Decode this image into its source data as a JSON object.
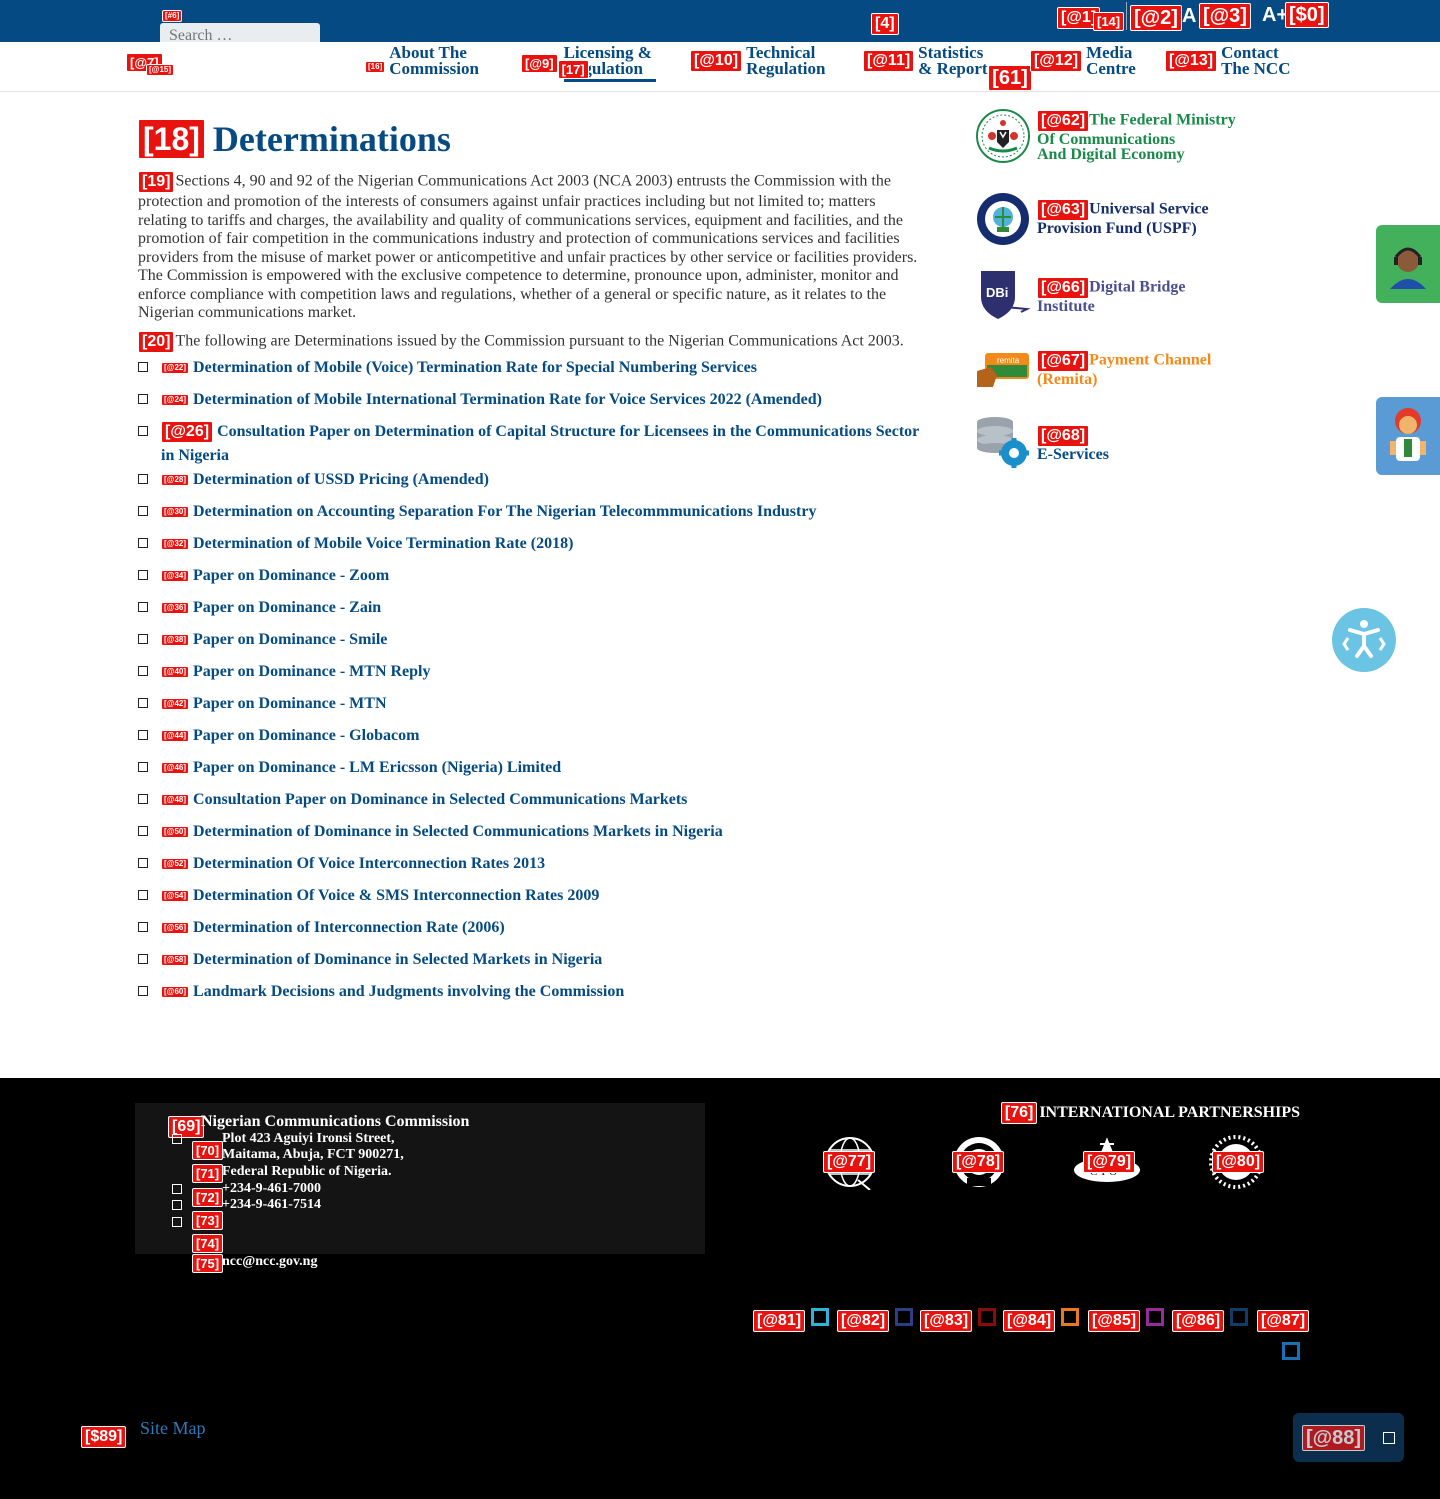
{
  "colors": {
    "primary": "#054a82",
    "tag": "#e8130f",
    "footer_bg": "#000000",
    "fmi_green": "#1a8a4a",
    "uspf_navy": "#152d6e",
    "dbi_purple": "#4b4e8f",
    "remita_orange": "#f28a1a"
  },
  "topbar": {
    "search_tag": "[#6]",
    "search_placeholder": "Search …",
    "tag_4": "[4]",
    "tag_a1": "[@1]",
    "tag_14": "[14]",
    "tag_a2": "[@2]",
    "font_normal": "A",
    "tag_a3": "[@3]",
    "font_plus": "A+",
    "tag_0": "[$0]"
  },
  "nav": {
    "logo_tag": "[@7]",
    "logo_tag_small": "[@15]",
    "items": [
      {
        "tag": "[16]",
        "line1": "About The",
        "line2": "Commission"
      },
      {
        "tag": "[@9]",
        "tag2": "[17]",
        "line1": "Licensing &",
        "line2": "Regulation"
      },
      {
        "tag": "[@10]",
        "line1": "Technical",
        "line2": "Regulation"
      },
      {
        "tag": "[@11]",
        "tag2": "[61]",
        "line1": "Statistics",
        "line2": "& Reports"
      },
      {
        "tag": "[@12]",
        "line1": "Media",
        "line2": "Centre"
      },
      {
        "tag": "[@13]",
        "line1": "Contact",
        "line2": "The NCC"
      }
    ]
  },
  "main": {
    "title_tag": "[18]",
    "title": "Determinations",
    "intro1_tag": "[19]",
    "intro1": "Sections 4, 90 and 92 of the Nigerian Communications Act 2003 (NCA 2003) entrusts the Commission with the protection and promotion of the interests of consumers against unfair practices including but not limited to; matters relating to tariffs and charges, the availability and quality of communications services, equipment and facilities, and the promotion of fair competition in the communications industry and protection of communications services and facilities providers from the misuse of market power or anticompetitive and unfair practices by other service or facilities providers. The Commission is empowered with the exclusive competence to determine, pronounce upon, administer, monitor and enforce compliance with competition laws and regulations, whether of a general or specific nature, as it relates to the Nigerian communications market.",
    "intro2_tag": "[20]",
    "intro2": "The following are Determinations issued by the Commission pursuant to the Nigerian Communications Act 2003.",
    "documents": [
      {
        "tag": "[@22]",
        "title": "Determination of Mobile (Voice) Termination Rate for Special Numbering Services"
      },
      {
        "tag": "[@24]",
        "title": "Determination of Mobile International Termination Rate for Voice Services 2022 (Amended)"
      },
      {
        "tag": "[@26]",
        "title": "Consultation Paper on Determination of Capital Structure for Licensees in the Communications Sector in Nigeria"
      },
      {
        "tag": "[@28]",
        "title": "Determination of USSD Pricing (Amended)"
      },
      {
        "tag": "[@30]",
        "title": "Determination on Accounting Separation For The Nigerian Telecommmunications Industry"
      },
      {
        "tag": "[@32]",
        "title": "Determination of Mobile Voice Termination Rate (2018)"
      },
      {
        "tag": "[@34]",
        "title": "Paper on Dominance - Zoom"
      },
      {
        "tag": "[@36]",
        "title": "Paper on Dominance - Zain"
      },
      {
        "tag": "[@38]",
        "title": "Paper on Dominance - Smile"
      },
      {
        "tag": "[@40]",
        "title": "Paper on Dominance - MTN Reply"
      },
      {
        "tag": "[@42]",
        "title": "Paper on Dominance - MTN"
      },
      {
        "tag": "[@44]",
        "title": "Paper on Dominance - Globacom"
      },
      {
        "tag": "[@46]",
        "title": "Paper on Dominance - LM Ericsson (Nigeria) Limited"
      },
      {
        "tag": "[@48]",
        "title": "Consultation Paper on Dominance in Selected Communications Markets"
      },
      {
        "tag": "[@50]",
        "title": "Determination of Dominance in Selected Communications Markets in Nigeria"
      },
      {
        "tag": "[@52]",
        "title": "Determination Of Voice Interconnection Rates 2013"
      },
      {
        "tag": "[@54]",
        "title": "Determination Of Voice & SMS Interconnection Rates 2009"
      },
      {
        "tag": "[@56]",
        "title": "Determination of Interconnection Rate (2006)"
      },
      {
        "tag": "[@58]",
        "title": "Determination of Dominance in Selected Markets in Nigeria"
      },
      {
        "tag": "[@60]",
        "title": "Landmark Decisions and Judgments involving the Commission"
      }
    ]
  },
  "sidebar": {
    "items": [
      {
        "tag": "[@62]",
        "line1": "The Federal Ministry",
        "line2": "Of Communications",
        "line3": "And Digital Economy",
        "icon": "nigeria-coat-of-arms-icon"
      },
      {
        "tag": "[@63]",
        "line1": "Universal Service",
        "line2": "Provision Fund (USPF)",
        "icon": "uspf-logo-icon"
      },
      {
        "tag": "[@66]",
        "line1": "Digital Bridge",
        "line2": "Institute",
        "icon": "dbi-logo-icon"
      },
      {
        "tag": "[@67]",
        "line1": "Payment Channel",
        "line2": "(Remita)",
        "icon": "remita-card-icon"
      },
      {
        "tag": "[@68]",
        "line1": "",
        "line2": "E-Services",
        "icon": "database-gear-icon"
      }
    ]
  },
  "footer": {
    "contact_tag": "[69]",
    "org_name": "Nigerian Communications Commission",
    "addr_tag1": "[70]",
    "addr1": "Plot 423 Aguiyi Ironsi Street,",
    "addr2": "Maitama, Abuja, FCT 900271,",
    "addr_tag2": "[71]",
    "addr3": "Federal Republic of Nigeria.",
    "phone_tag": "[72]",
    "phone1": "+234-9-461-7000",
    "phone2": "+234-9-461-7514",
    "tag_73": "[73]",
    "tag_74": "[74]",
    "email_tag": "[75]",
    "email": "ncc@ncc.gov.ng",
    "partners_tag": "[76]",
    "partners_title": "INTERNATIONAL PARTNERSHIPS",
    "partners": [
      {
        "tag": "[@77]",
        "icon": "itu-globe-icon"
      },
      {
        "tag": "[@78]",
        "icon": "atu-emblem-icon"
      },
      {
        "tag": "[@79]",
        "icon": "cto-logo-icon"
      },
      {
        "tag": "[@80]",
        "icon": "wati-sun-icon"
      }
    ],
    "socials": [
      {
        "tag": "[@81]",
        "color": "#29b6d9"
      },
      {
        "tag": "[@82]",
        "color": "#2c3e86"
      },
      {
        "tag": "[@83]",
        "color": "#8b0a0a"
      },
      {
        "tag": "[@84]",
        "color": "#e87a1b"
      },
      {
        "tag": "[@85]",
        "color": "#9a2a9a"
      },
      {
        "tag": "[@86]",
        "color": "#0f3d68"
      },
      {
        "tag": "[@87]",
        "color": "#1b6fb5"
      }
    ],
    "sitemap_tag": "[$89]",
    "sitemap": "Site Map",
    "backtop_tag": "[@88]"
  }
}
